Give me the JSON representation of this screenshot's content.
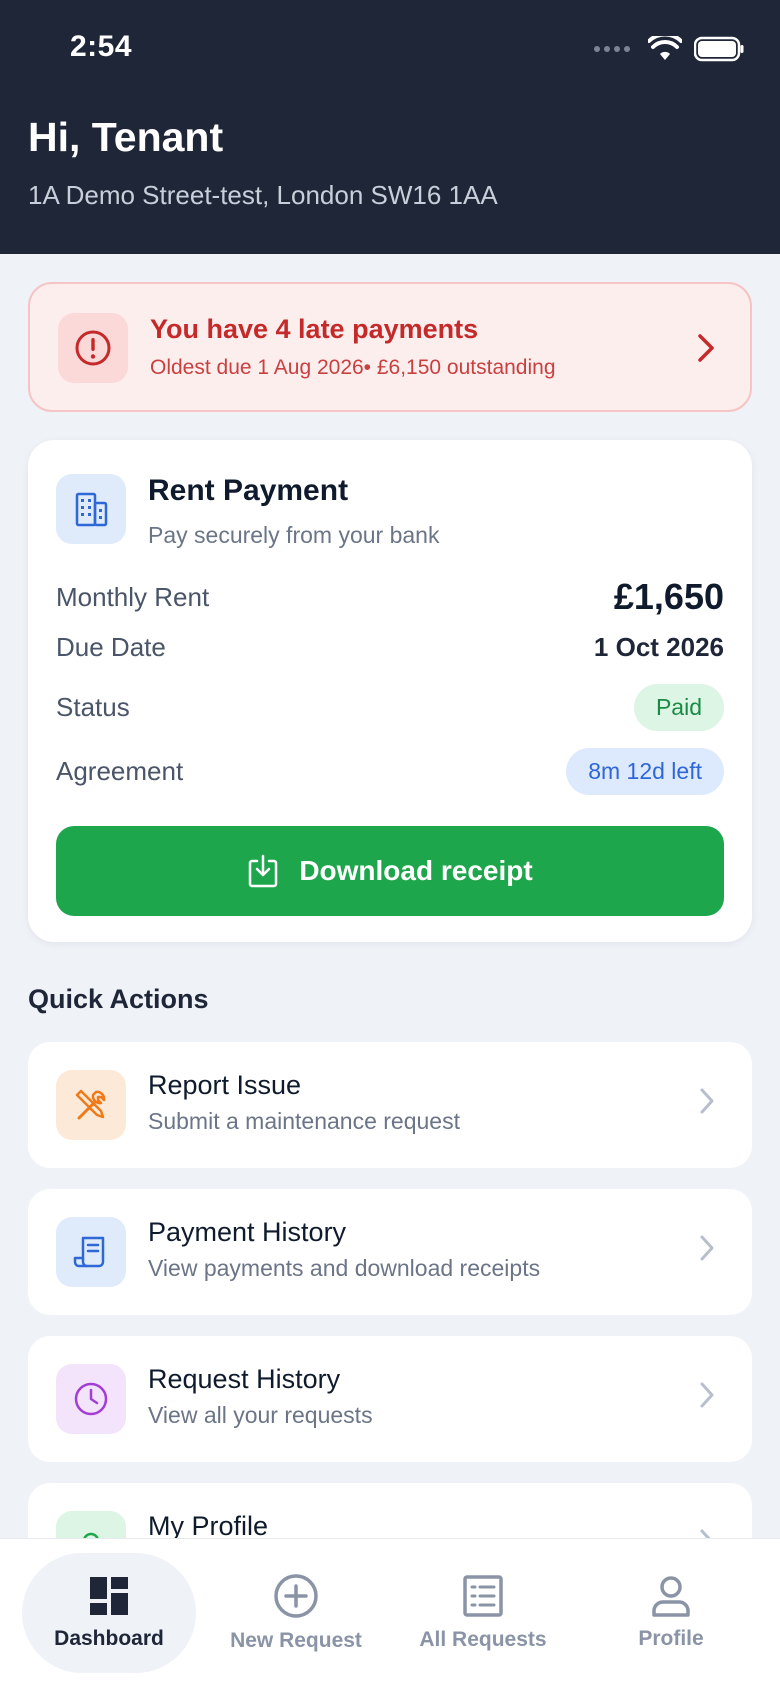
{
  "status_bar": {
    "time": "2:54"
  },
  "header": {
    "greeting": "Hi, Tenant",
    "address": "1A Demo Street-test, London SW16 1AA"
  },
  "alert": {
    "title": "You have 4 late payments",
    "subtitle": "Oldest due 1 Aug 2026• £6,150  outstanding",
    "color": "#c42a2a"
  },
  "rent_card": {
    "title": "Rent Payment",
    "subtitle": "Pay securely from your bank",
    "rows": {
      "monthly_rent": {
        "label": "Monthly Rent",
        "value": "£1,650"
      },
      "due_date": {
        "label": "Due Date",
        "value": "1 Oct 2026"
      },
      "status": {
        "label": "Status",
        "value": "Paid"
      },
      "agreement": {
        "label": "Agreement",
        "value": "8m 12d left"
      }
    },
    "download_label": "Download receipt",
    "accent": "#1ea64c"
  },
  "quick_actions": {
    "title": "Quick Actions",
    "items": [
      {
        "title": "Report Issue",
        "subtitle": "Submit a maintenance request",
        "icon": "tools-icon",
        "color": "#f07a1a"
      },
      {
        "title": "Payment History",
        "subtitle": "View payments and download receipts",
        "icon": "receipt-icon",
        "color": "#2e67d6"
      },
      {
        "title": "Request History",
        "subtitle": "View all your requests",
        "icon": "clock-icon",
        "color": "#a23ed6"
      },
      {
        "title": "My Profile",
        "subtitle": "",
        "icon": "profile-icon",
        "color": "#1ea64c"
      }
    ]
  },
  "tabbar": {
    "tabs": [
      {
        "label": "Dashboard",
        "icon": "dashboard-icon",
        "active": true
      },
      {
        "label": "New Request",
        "icon": "plus-circle-icon",
        "active": false
      },
      {
        "label": "All Requests",
        "icon": "list-icon",
        "active": false
      },
      {
        "label": "Profile",
        "icon": "person-icon",
        "active": false
      }
    ]
  }
}
